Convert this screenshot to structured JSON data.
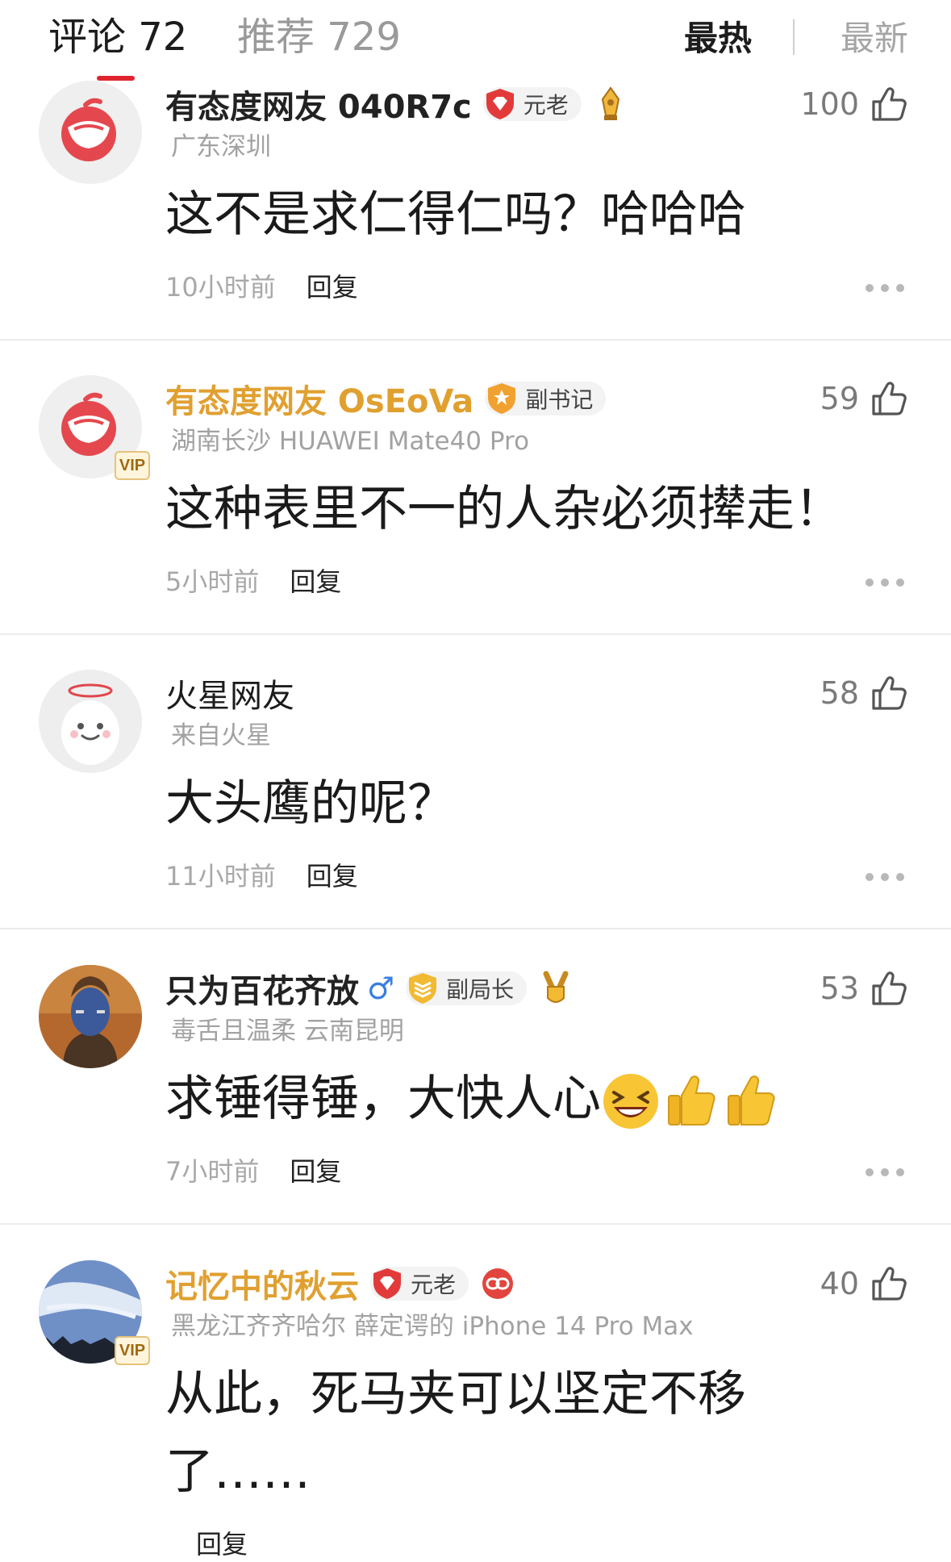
{
  "header": {
    "tab_comments": "评论 72",
    "tab_recommend": "推荐 729",
    "sort_hot": "最热",
    "sort_new": "最新"
  },
  "colors": {
    "accent_red": "#e0242e",
    "gold_name": "#e0a030",
    "muted": "#a2a2a2"
  },
  "comments": [
    {
      "name": "有态度网友 040R7c",
      "badge": "元老",
      "badge_icon": "red-diamond-shield-icon",
      "extra_icon": "gold-pen-medal-icon",
      "meta": "广东深圳",
      "text": "这不是求仁得仁吗？哈哈哈",
      "time": "10小时前",
      "reply": "回复",
      "likes": "100",
      "vip": false
    },
    {
      "name": "有态度网友 OsEoVa",
      "badge": "副书记",
      "badge_icon": "orange-star-shield-icon",
      "meta": "湖南长沙 HUAWEI Mate40 Pro",
      "text": "这种表里不一的人杂必须撵走！",
      "time": "5小时前",
      "reply": "回复",
      "likes": "59",
      "vip": true,
      "vip_label": "VIP"
    },
    {
      "name": "火星网友",
      "meta": "来自火星",
      "text": "大头鹰的呢？",
      "time": "11小时前",
      "reply": "回复",
      "likes": "58",
      "vip": false
    },
    {
      "name": "只为百花齐放",
      "gender_icon": "male-icon",
      "gender_symbol": "♂",
      "badge": "副局长",
      "badge_icon": "gold-layers-shield-icon",
      "extra_icon": "victory-hand-medal-icon",
      "meta": "毒舌且温柔 云南昆明",
      "text": "求锤得锤，大快人心",
      "emojis": [
        "laughing-face-icon",
        "thumbs-up-icon",
        "thumbs-up-icon"
      ],
      "time": "7小时前",
      "reply": "回复",
      "likes": "53",
      "vip": false
    },
    {
      "name": "记忆中的秋云",
      "badge": "元老",
      "badge_icon": "red-diamond-shield-icon",
      "extra_icon": "red-chain-badge-icon",
      "meta": "黑龙江齐齐哈尔 薛定谔的 iPhone 14 Pro Max",
      "text": "从此，死马夹可以坚定不移了……",
      "time": "",
      "reply": "回复",
      "likes": "40",
      "vip": true,
      "vip_label": "VIP"
    }
  ]
}
